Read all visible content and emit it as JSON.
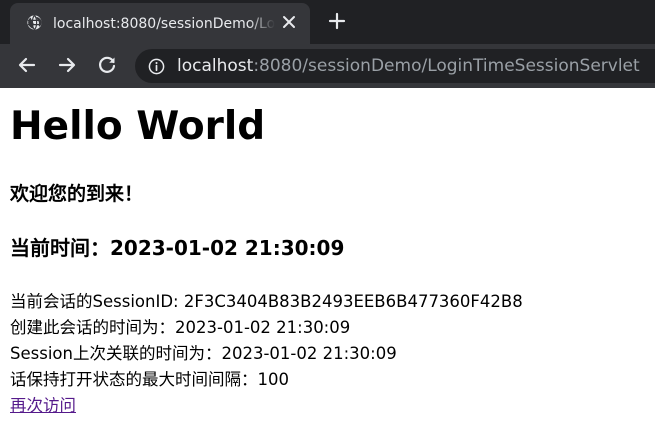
{
  "browser": {
    "tab": {
      "title": "localhost:8080/sessionDemo/LoginTimeSessionServlet",
      "favicon": "globe-icon",
      "close_icon": "close-icon"
    },
    "new_tab_icon": "plus-icon",
    "nav": {
      "back_icon": "arrow-left-icon",
      "forward_icon": "arrow-right-icon",
      "reload_icon": "reload-icon"
    },
    "address_bar": {
      "info_icon": "info-icon",
      "host": "localhost",
      "rest": ":8080/sessionDemo/LoginTimeSessionServlet"
    }
  },
  "page": {
    "heading": "Hello World",
    "welcome": "欢迎您的到来！",
    "current_time_heading": "当前时间：2023-01-02 21:30:09",
    "session_info": [
      "当前会话的SessionID: 2F3C3404B83B2493EEB6B477360F42B8",
      "创建此会话的时间为：2023-01-02 21:30:09",
      "Session上次关联的时间为：2023-01-02 21:30:09",
      "话保持打开状态的最大时间间隔：100"
    ],
    "revisit_link": "再次访问"
  },
  "colors": {
    "chrome_dark": "#202124",
    "chrome_toolbar": "#35363a",
    "chrome_text": "#e8eaed",
    "url_dim": "#9aa0a6",
    "visited_link": "#551a8b"
  }
}
